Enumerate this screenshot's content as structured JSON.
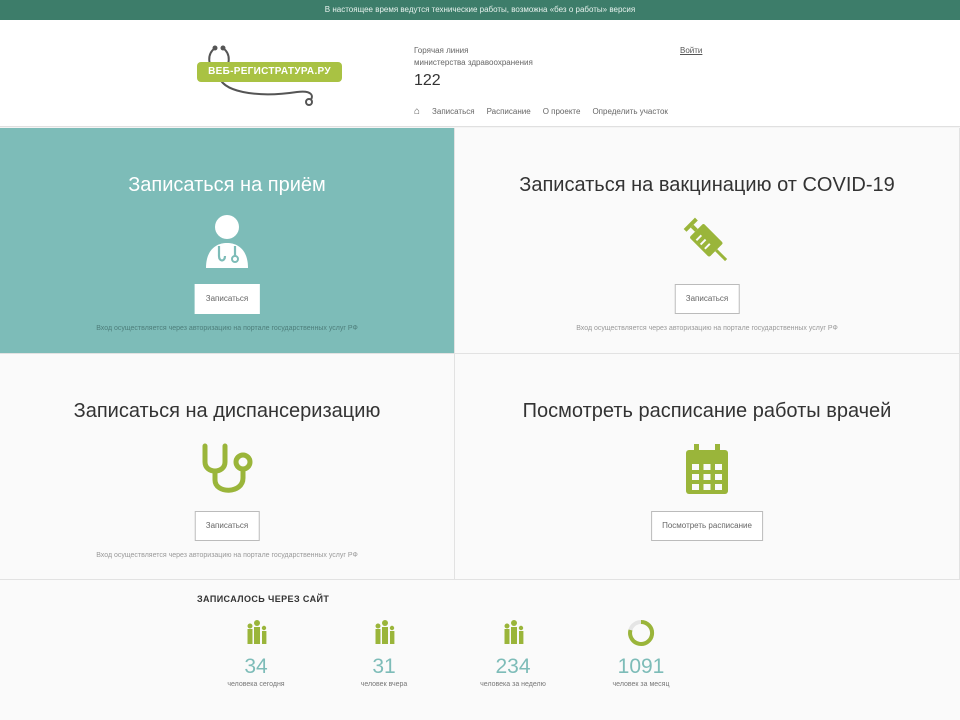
{
  "topbar": {
    "text": "В настоящее время ведутся технические работы, возможна «без о работы» версия"
  },
  "header": {
    "logo_text": "ВЕБ-РЕГИСТРАТУРА.РУ",
    "label": "Горячая линия",
    "sublabel": "министерства здравоохранения",
    "phone": "122",
    "link": "Войти",
    "nav": [
      "Записаться",
      "Расписание",
      "О проекте",
      "Определить участок"
    ]
  },
  "tiles": [
    {
      "title": "Записаться на приём",
      "button": "Записаться",
      "note": "Вход осуществляется через авторизацию на портале государственных услуг РФ",
      "icon": "doctor-icon",
      "active": true
    },
    {
      "title": "Записаться на вакцинацию от COVID-19",
      "button": "Записаться",
      "note": "Вход осуществляется через авторизацию на портале государственных услуг РФ",
      "icon": "syringe-icon"
    },
    {
      "title": "Записаться на диспансеризацию",
      "button": "Записаться",
      "note": "Вход осуществляется через авторизацию на портале государственных услуг РФ",
      "icon": "stethoscope-icon"
    },
    {
      "title": "Посмотреть расписание работы врачей",
      "button": "Посмотреть расписание",
      "icon": "calendar-icon"
    }
  ],
  "stats": {
    "title": "ЗАПИСАЛОСЬ ЧЕРЕЗ САЙТ",
    "items": [
      {
        "value": "34",
        "label": "человека сегодня",
        "icon": "people-icon"
      },
      {
        "value": "31",
        "label": "человек вчера",
        "icon": "people-icon"
      },
      {
        "value": "234",
        "label": "человека за неделю",
        "icon": "people-icon"
      },
      {
        "value": "1091",
        "label": "человек за месяц",
        "icon": "progress-ring-icon"
      }
    ]
  },
  "colors": {
    "accent": "#7dbcb8",
    "green": "#9ab53a",
    "topbar": "#3d7d6a"
  }
}
